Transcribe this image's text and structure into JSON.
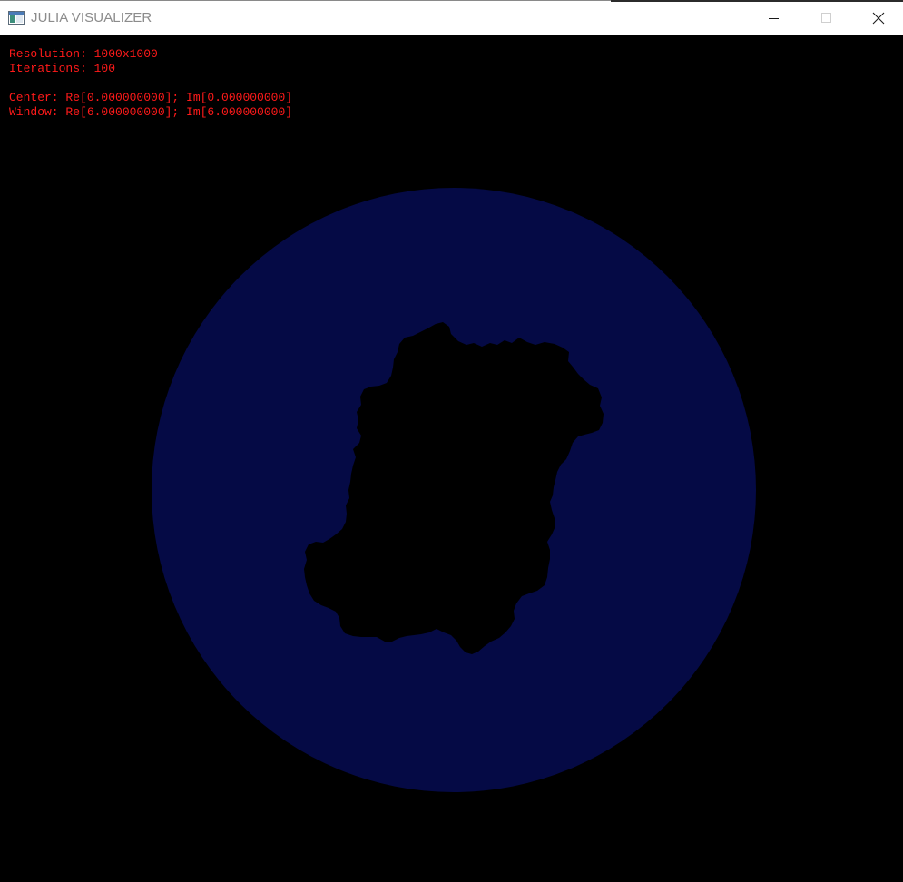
{
  "window": {
    "title": "JULIA VISUALIZER",
    "icon": "app-window-icon",
    "controls": {
      "minimize_icon": "minimize-icon",
      "maximize_icon": "maximize-icon",
      "close_icon": "close-icon"
    }
  },
  "hud": {
    "resolution": "Resolution: 1000x1000",
    "iterations": "Iterations: 100",
    "center": "Center: Re[0.000000000]; Im[0.000000000]",
    "window": "Window: Re[6.000000000]; Im[6.000000000]"
  },
  "colors": {
    "background": "#000000",
    "escape_disc": "#050a45",
    "julia_set": "#000000",
    "hud_text": "#ff1a1a",
    "title_text": "#8c8c8c"
  }
}
